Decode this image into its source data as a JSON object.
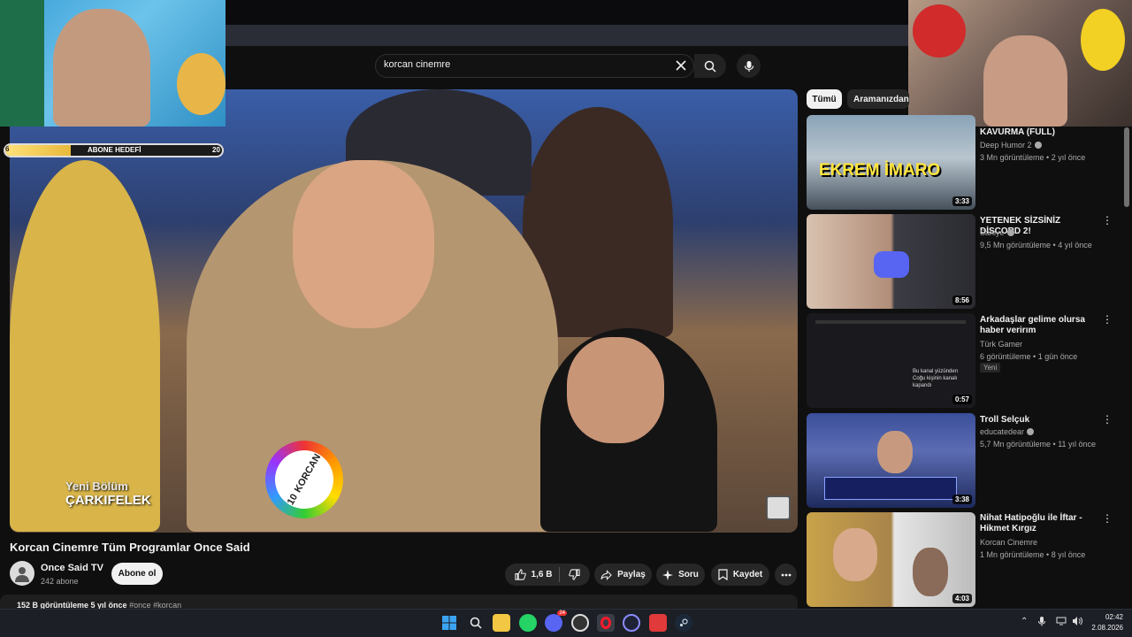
{
  "search": {
    "query": "korcan cinemre"
  },
  "overlay": {
    "goal_min": "6",
    "goal_title": "ABONE HEDEFİ",
    "goal_max": "20",
    "goal_progress": 0.3
  },
  "video": {
    "overlay_line1": "Yeni Bölüm",
    "overlay_line2": "ÇARKIFELEK",
    "nametag_number": "10",
    "nametag_name": "KORCAN",
    "title": "Korcan Cinemre Tüm Programlar Once Said",
    "channel_name": "Once Said TV",
    "channel_subs": "242 abone",
    "subscribe_label": "Abone ol",
    "like_count": "1,6 B",
    "share_label": "Paylaş",
    "ask_label": "Soru",
    "save_label": "Kaydet",
    "views_date": "152 B görüntüleme  5 yıl önce",
    "hashtags": "#once #korcan"
  },
  "sidebar": {
    "chips": [
      "Tümü",
      "Aramanızdan"
    ],
    "items": [
      {
        "title": "KAVURMA (FULL)",
        "channel": "Deep Humor 2",
        "verified": true,
        "meta": "3 Mn görüntüleme • 2 yıl önce",
        "duration": "3:33",
        "thumb_text": "EKREM İMARO",
        "badge": ""
      },
      {
        "title": "YETENEK SİZSİNİZ DİSCORD 2!",
        "channel": "Saniye",
        "verified": true,
        "meta": "9,5 Mn görüntüleme • 4 yıl önce",
        "duration": "8:56",
        "thumb_text": "",
        "badge": ""
      },
      {
        "title": "Arkadaşlar gelime olursa haber verirım",
        "channel": "Türk Gamer",
        "verified": false,
        "meta": "6 görüntüleme • 1 gün önce",
        "duration": "0:57",
        "thumb_text": "Bu kanal yüzünden Coğu kişinin kanalı kapandı",
        "badge": "Yeni"
      },
      {
        "title": "Troll Selçuk",
        "channel": "educatedear",
        "verified": true,
        "meta": "5,7 Mn görüntüleme • 11 yıl önce",
        "duration": "3:38",
        "thumb_text": "",
        "badge": ""
      },
      {
        "title": "Nihat Hatipoğlu ile İftar - Hikmet Kırgız",
        "channel": "Korcan Cinemre",
        "verified": false,
        "meta": "1 Mn görüntüleme • 8 yıl önce",
        "duration": "4:03",
        "thumb_text": "",
        "badge": ""
      }
    ]
  },
  "taskbar": {
    "time": "02:42",
    "date": "2.08.2026",
    "discord_badge": "24"
  }
}
